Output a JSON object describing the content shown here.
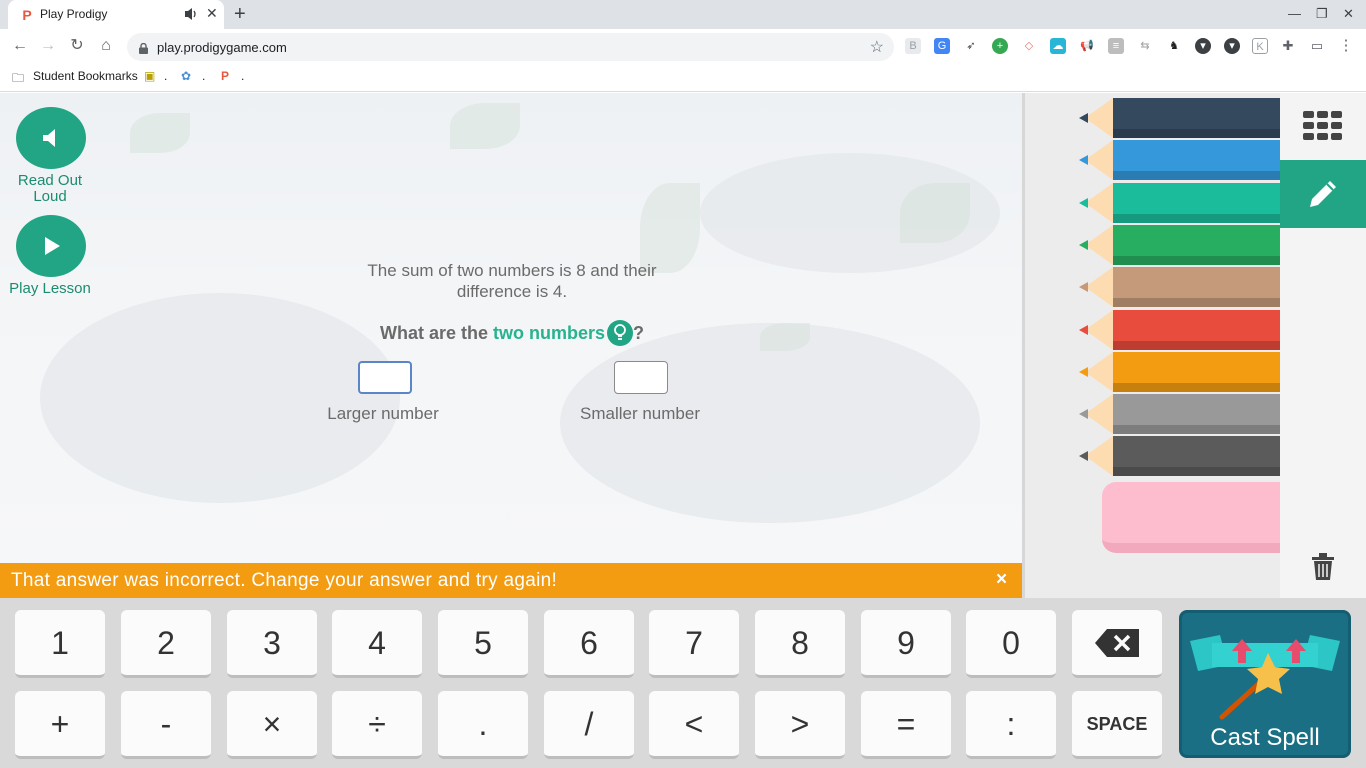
{
  "browser": {
    "tab_title": "Play Prodigy",
    "url": "play.prodigygame.com",
    "bookmarks": [
      {
        "label": "Student Bookmarks"
      },
      {
        "label": "."
      },
      {
        "label": "."
      },
      {
        "label": "."
      }
    ]
  },
  "sidebar": {
    "read_out_loud": "Read Out Loud",
    "play_lesson": "Play Lesson"
  },
  "question": {
    "text": "The sum of two numbers is 8 and their difference is 4.",
    "prompt_prefix": "What are the ",
    "prompt_highlight": "two numbers",
    "prompt_suffix": "?",
    "answers": [
      {
        "label": "Larger number",
        "value": ""
      },
      {
        "label": "Smaller number",
        "value": ""
      }
    ]
  },
  "feedback": {
    "message": "That answer was incorrect. Change your answer and try again!",
    "close": "×"
  },
  "drawing_panel": {
    "pencil_colors": [
      "#34495e",
      "#3498db",
      "#1abc9c",
      "#27ae60",
      "#c49a7a",
      "#e74c3c",
      "#f39c12",
      "#999999",
      "#5b5b5b"
    ]
  },
  "keypad": {
    "row1": [
      "1",
      "2",
      "3",
      "4",
      "5",
      "6",
      "7",
      "8",
      "9",
      "0"
    ],
    "row2": [
      "+",
      "-",
      "×",
      "÷",
      ".",
      "/",
      "<",
      ">",
      "=",
      ":"
    ],
    "space": "SPACE",
    "cast_spell": "Cast Spell"
  },
  "colors": {
    "accent": "#22a585",
    "feedback": "#f39c12",
    "cast_spell_bg": "#1a6f84"
  }
}
